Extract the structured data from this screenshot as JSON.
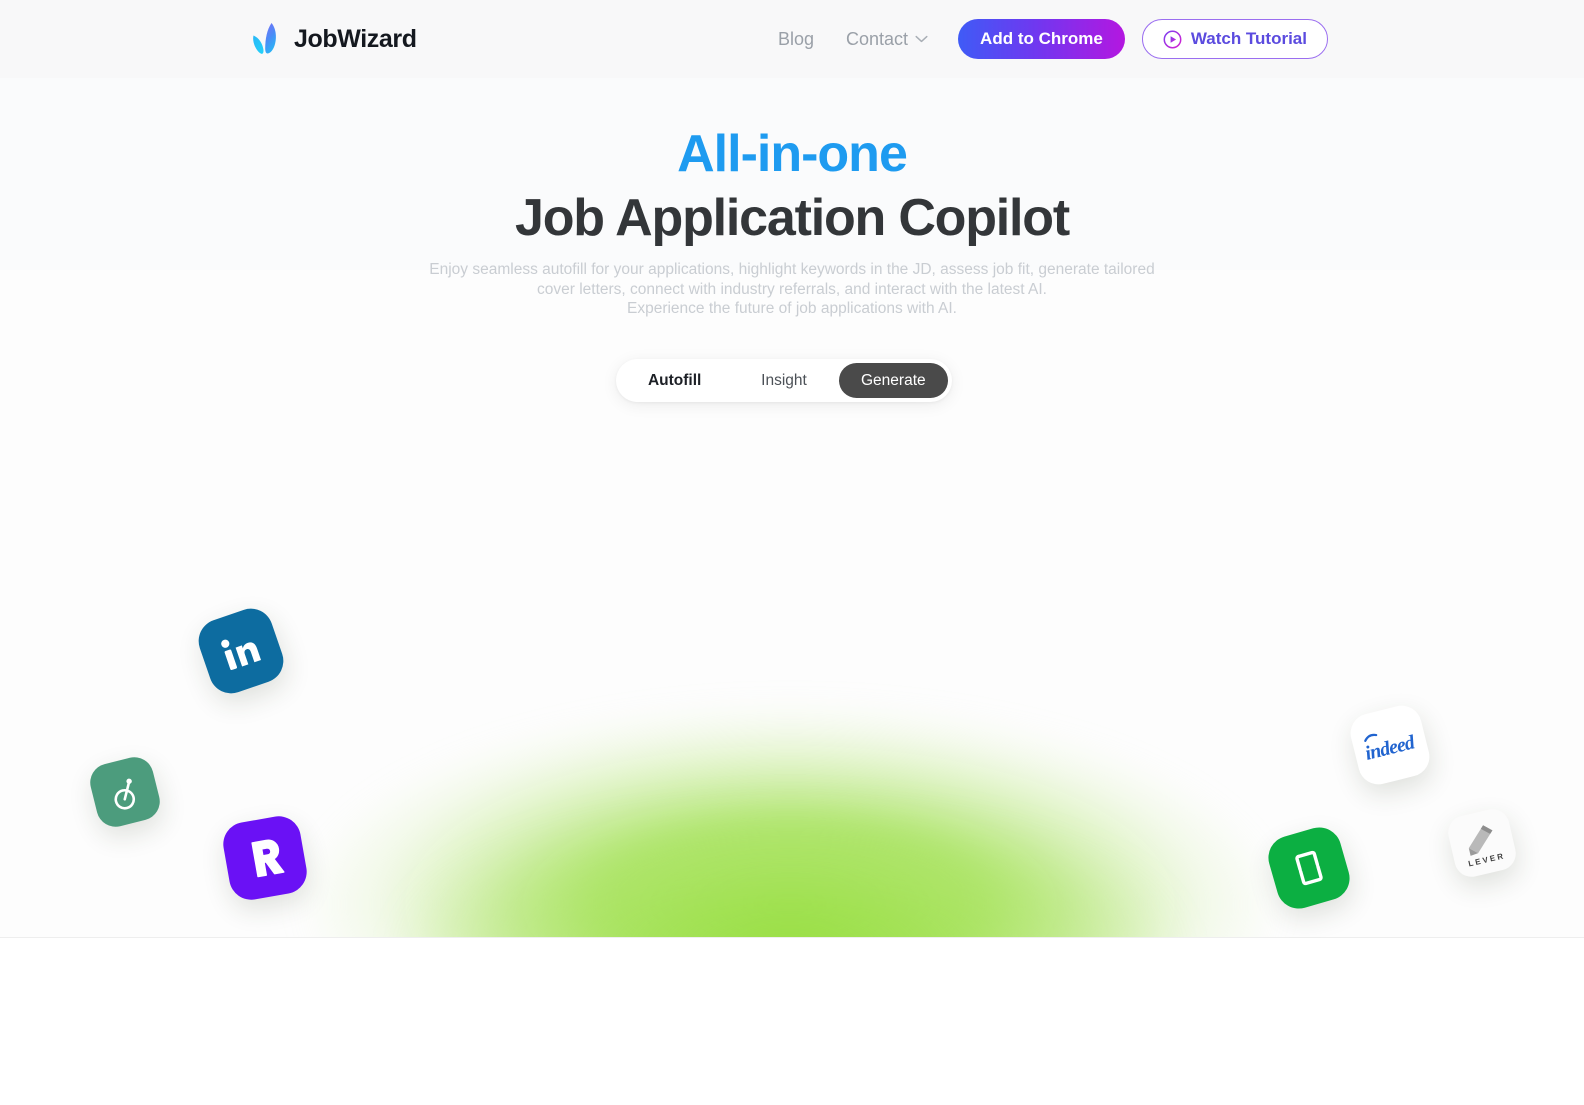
{
  "brand": {
    "name": "JobWizard",
    "logo_icon": "sprout-leaf-icon",
    "logo_colors": [
      "#6a6ef5",
      "#2bb3f6",
      "#29c6f7"
    ]
  },
  "nav": {
    "links": [
      {
        "label": "Blog",
        "icon": null
      },
      {
        "label": "Contact",
        "icon": "chevron-down-icon"
      }
    ],
    "add_to_chrome": {
      "label": "Add to Chrome",
      "gradient_from": "#3f5bf6",
      "gradient_to": "#b417e0"
    },
    "watch_tutorial": {
      "label": "Watch Tutorial",
      "icon": "play-circle-icon",
      "text_color": "#5b4bdf",
      "border_color": "#9b6ef0"
    }
  },
  "hero": {
    "headline_line1": "All-in-one",
    "headline_line2": "Job Application Copilot",
    "headline_line1_color": "#1e9bf0",
    "headline_line2_color": "#333639",
    "subtitle_line1": "Enjoy seamless autofill for your applications, highlight keywords in the JD, assess job fit, generate tailored",
    "subtitle_line2": "cover letters, connect with industry referrals, and interact with the latest AI.",
    "subtitle_line3": "Experience the future of job applications with AI.",
    "glow_color": "#9de04d"
  },
  "tabs": {
    "items": [
      {
        "label": "Autofill",
        "active": false
      },
      {
        "label": "Insight",
        "active": false
      },
      {
        "label": "Generate",
        "active": true
      }
    ],
    "active_background": "#4a4a4a"
  },
  "logos": [
    {
      "name": "linkedin",
      "label": "in",
      "background": "#0d6ca0"
    },
    {
      "name": "glassdoor-g",
      "label": "g",
      "background": "#4c9c7d"
    },
    {
      "name": "rippling",
      "label": "R",
      "background": "#6a11f5"
    },
    {
      "name": "indeed",
      "label": "indeed",
      "background": "#ffffff",
      "text_color": "#2164cf"
    },
    {
      "name": "greenhouse",
      "label": "",
      "background": "#0caf42"
    },
    {
      "name": "lever",
      "label": "LEVER",
      "background": "#fbfbfb",
      "text_color": "#3f3f3f"
    }
  ]
}
